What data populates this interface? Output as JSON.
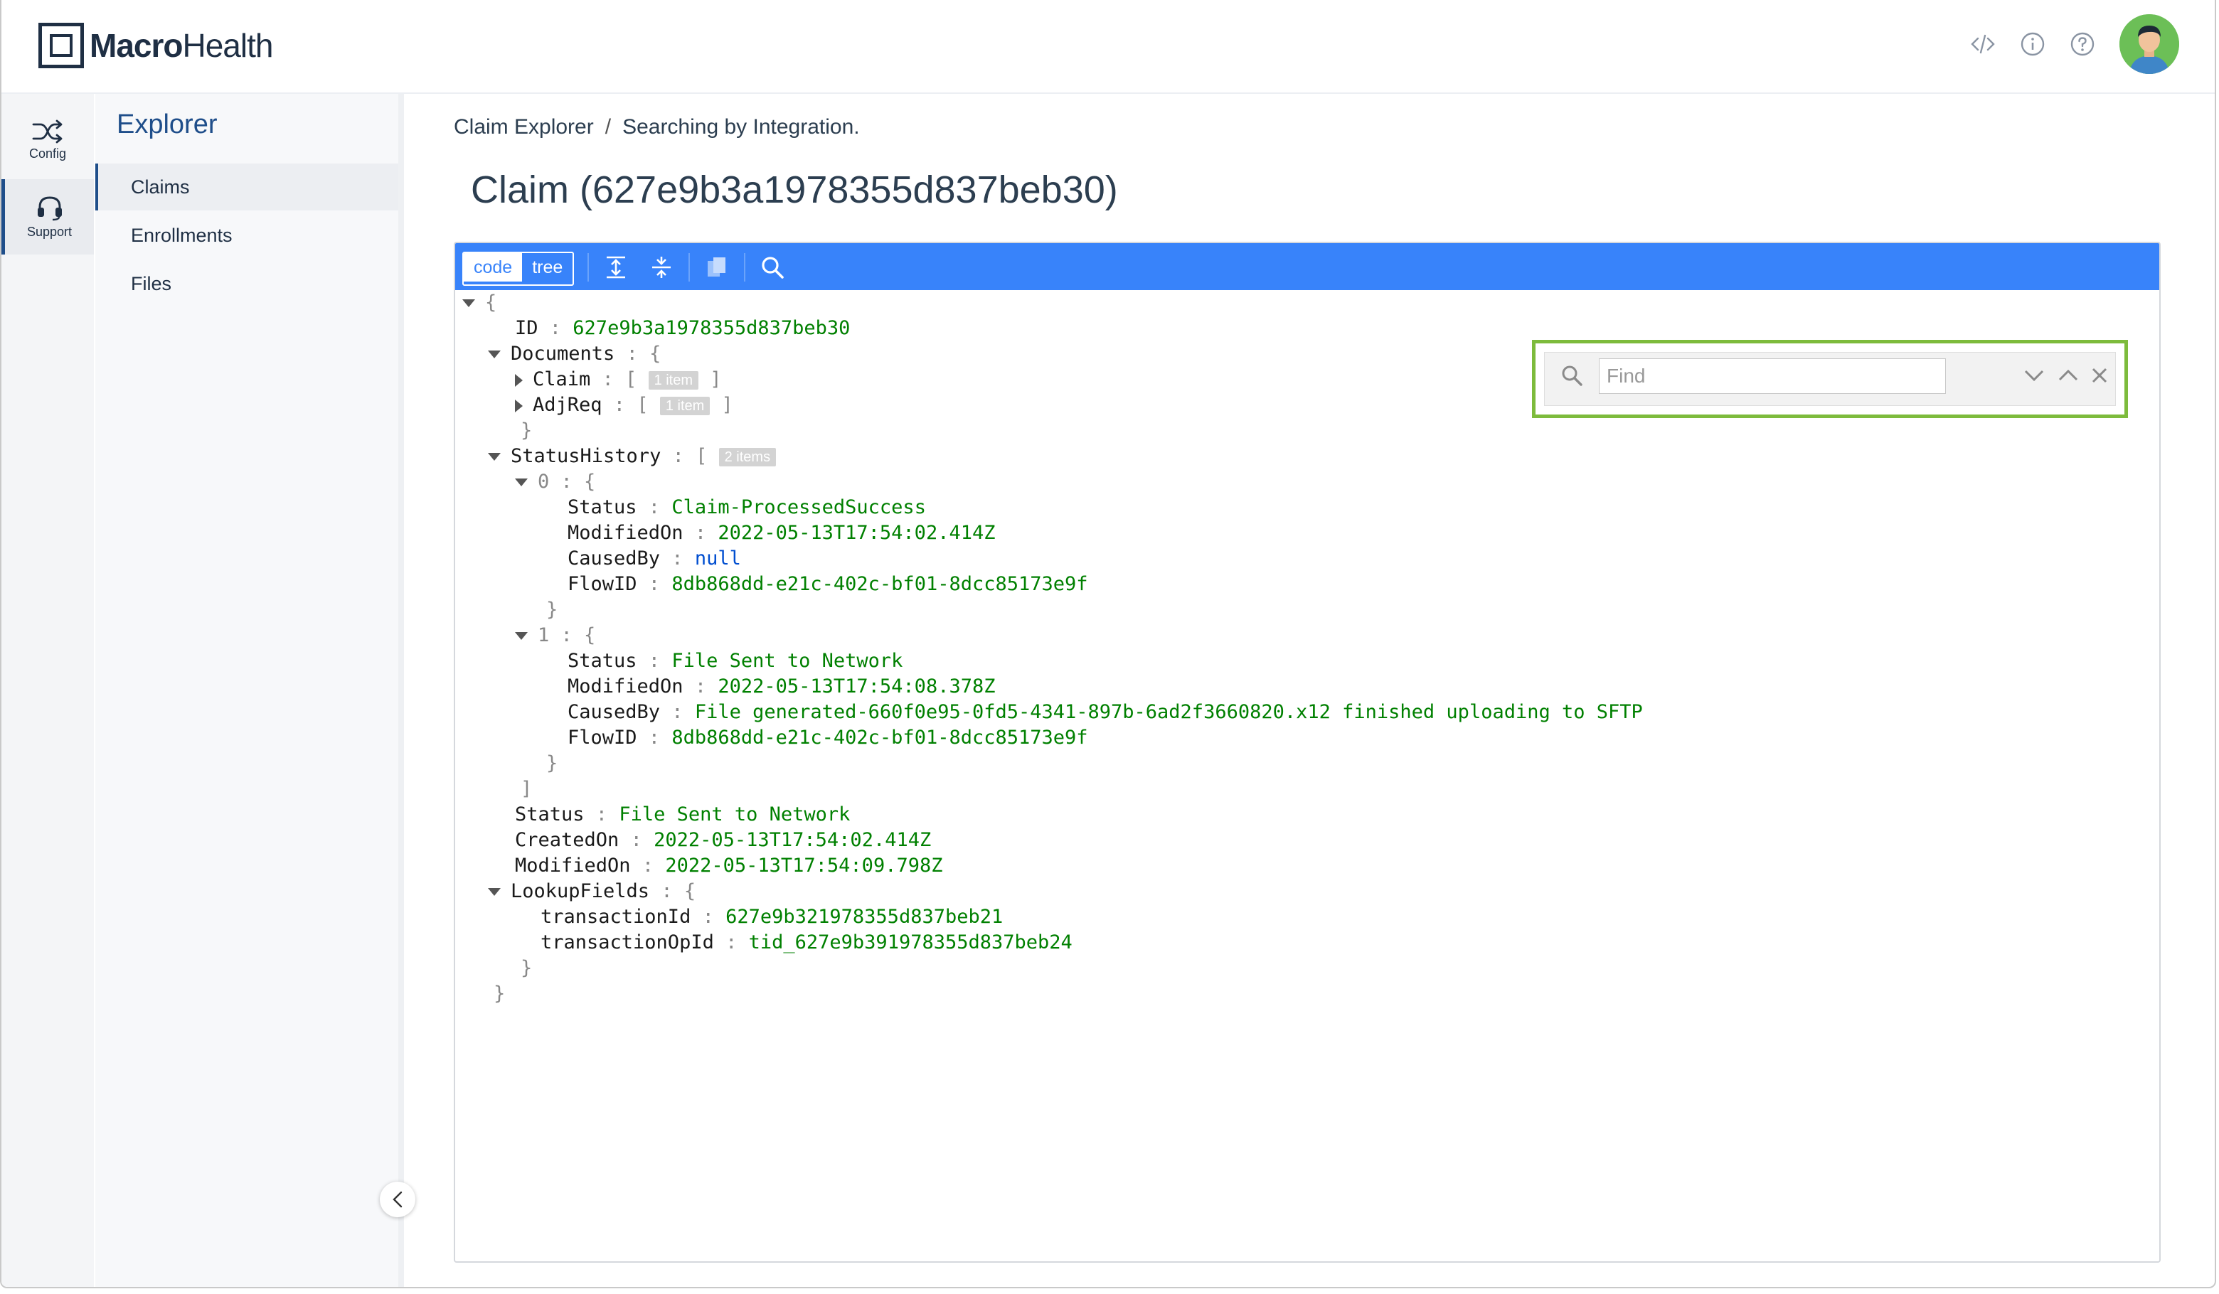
{
  "app": {
    "logo_bold": "Macro",
    "logo_light": "Health"
  },
  "header_icons": [
    "code-icon",
    "info-icon",
    "help-icon"
  ],
  "rail": [
    {
      "label": "Config",
      "icon": "shuffle-icon"
    },
    {
      "label": "Support",
      "icon": "headset-icon",
      "active": true
    }
  ],
  "sidebar": {
    "title": "Explorer",
    "items": [
      {
        "label": "Claims",
        "active": true
      },
      {
        "label": "Enrollments"
      },
      {
        "label": "Files"
      }
    ]
  },
  "breadcrumb": {
    "root": "Claim Explorer",
    "separator": "/",
    "current": "Searching by Integration."
  },
  "page_title": "Claim (627e9b3a1978355d837beb30)",
  "editor": {
    "modes": [
      "code",
      "tree"
    ],
    "active_mode": "tree",
    "find_placeholder": "Find",
    "find_value": "",
    "json": {
      "open_brace": "{",
      "close_brace": "}",
      "id_key": "ID",
      "id_value": "627e9b3a1978355d837beb30",
      "documents_key": "Documents",
      "claim_key": "Claim",
      "claim_count": "1 item",
      "adjreq_key": "AdjReq",
      "adjreq_count": "1 item",
      "status_history_key": "StatusHistory",
      "status_history_count": "2 items",
      "history": [
        {
          "index": "0",
          "status": "Claim-ProcessedSuccess",
          "modified_on": "2022-05-13T17:54:02.414Z",
          "caused_by": "null",
          "flow_id": "8db868dd-e21c-402c-bf01-8dcc85173e9f"
        },
        {
          "index": "1",
          "status": "File Sent to Network",
          "modified_on": "2022-05-13T17:54:08.378Z",
          "caused_by": "File generated-660f0e95-0fd5-4341-897b-6ad2f3660820.x12 finished uploading to SFTP",
          "flow_id": "8db868dd-e21c-402c-bf01-8dcc85173e9f"
        }
      ],
      "keys": {
        "status": "Status",
        "modified_on": "ModifiedOn",
        "caused_by": "CausedBy",
        "flow_id": "FlowID",
        "created_on": "CreatedOn",
        "lookup_fields": "LookupFields",
        "transaction_id": "transactionId",
        "transaction_op_id": "transactionOpId"
      },
      "status": "File Sent to Network",
      "created_on": "2022-05-13T17:54:02.414Z",
      "modified_on": "2022-05-13T17:54:09.798Z",
      "transaction_id": "627e9b321978355d837beb21",
      "transaction_op_id": "tid_627e9b391978355d837beb24"
    }
  }
}
